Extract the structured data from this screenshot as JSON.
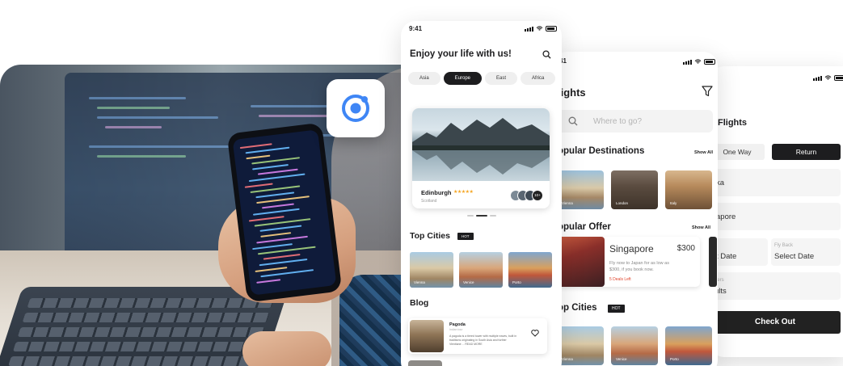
{
  "phone_home": {
    "time": "9:41",
    "headline": "Enjoy your life with us!",
    "regions": [
      {
        "label": "Asia",
        "active": false
      },
      {
        "label": "Europe",
        "active": true
      },
      {
        "label": "East",
        "active": false
      },
      {
        "label": "Africa",
        "active": false
      }
    ],
    "featured": {
      "name": "Edinburgh",
      "stars": "★★★★★",
      "subtitle": "Scotland",
      "more_count": "10+"
    },
    "top_cities_title": "Top Cities",
    "hot_badge": "HOT",
    "top_cities": [
      {
        "label": "Vienna"
      },
      {
        "label": "Venice"
      },
      {
        "label": "Porto"
      }
    ],
    "blog_title": "Blog",
    "blog_card": {
      "title": "Pagoda",
      "meta": "Indian tour",
      "text": "A pagoda is a tiered tower with multiple eaves, built in traditions originating in South Asia and further Vientiane ... READ MORE"
    }
  },
  "phone_flights": {
    "time": "41",
    "title": "lights",
    "search_placeholder": "Where to go?",
    "popular_destinations": "opular Destinations",
    "show_all": "Show All",
    "destinations": [
      {
        "label": "Vienna"
      },
      {
        "label": "London"
      },
      {
        "label": "Italy"
      }
    ],
    "popular_offer": "opular Offer",
    "offer": {
      "city": "Singapore",
      "price": "$300",
      "desc": "Fly now to Japan for as low as $300, if you book now.",
      "deals": "5 Deals Left"
    },
    "top_cities": "op Cities",
    "hot_badge": "HOT",
    "bottom_cities": [
      {
        "label": "Vienna"
      },
      {
        "label": "Venice"
      },
      {
        "label": "Porto"
      }
    ]
  },
  "phone_booking": {
    "title": "Flights",
    "trip_one_way": "One Way",
    "trip_return": "Return",
    "from_value": "ka",
    "to_value": "apore",
    "depart_value": "t Date",
    "return_caption": "Fly Back",
    "return_value": "Select Date",
    "passengers_caption": "gers",
    "passengers_value": "ults",
    "checkout": "Check Out"
  },
  "colors": {
    "dark": "#1d1d1f",
    "accent_blue": "#3f86f5",
    "star": "#f5a623",
    "deals_red": "#e0442c"
  }
}
